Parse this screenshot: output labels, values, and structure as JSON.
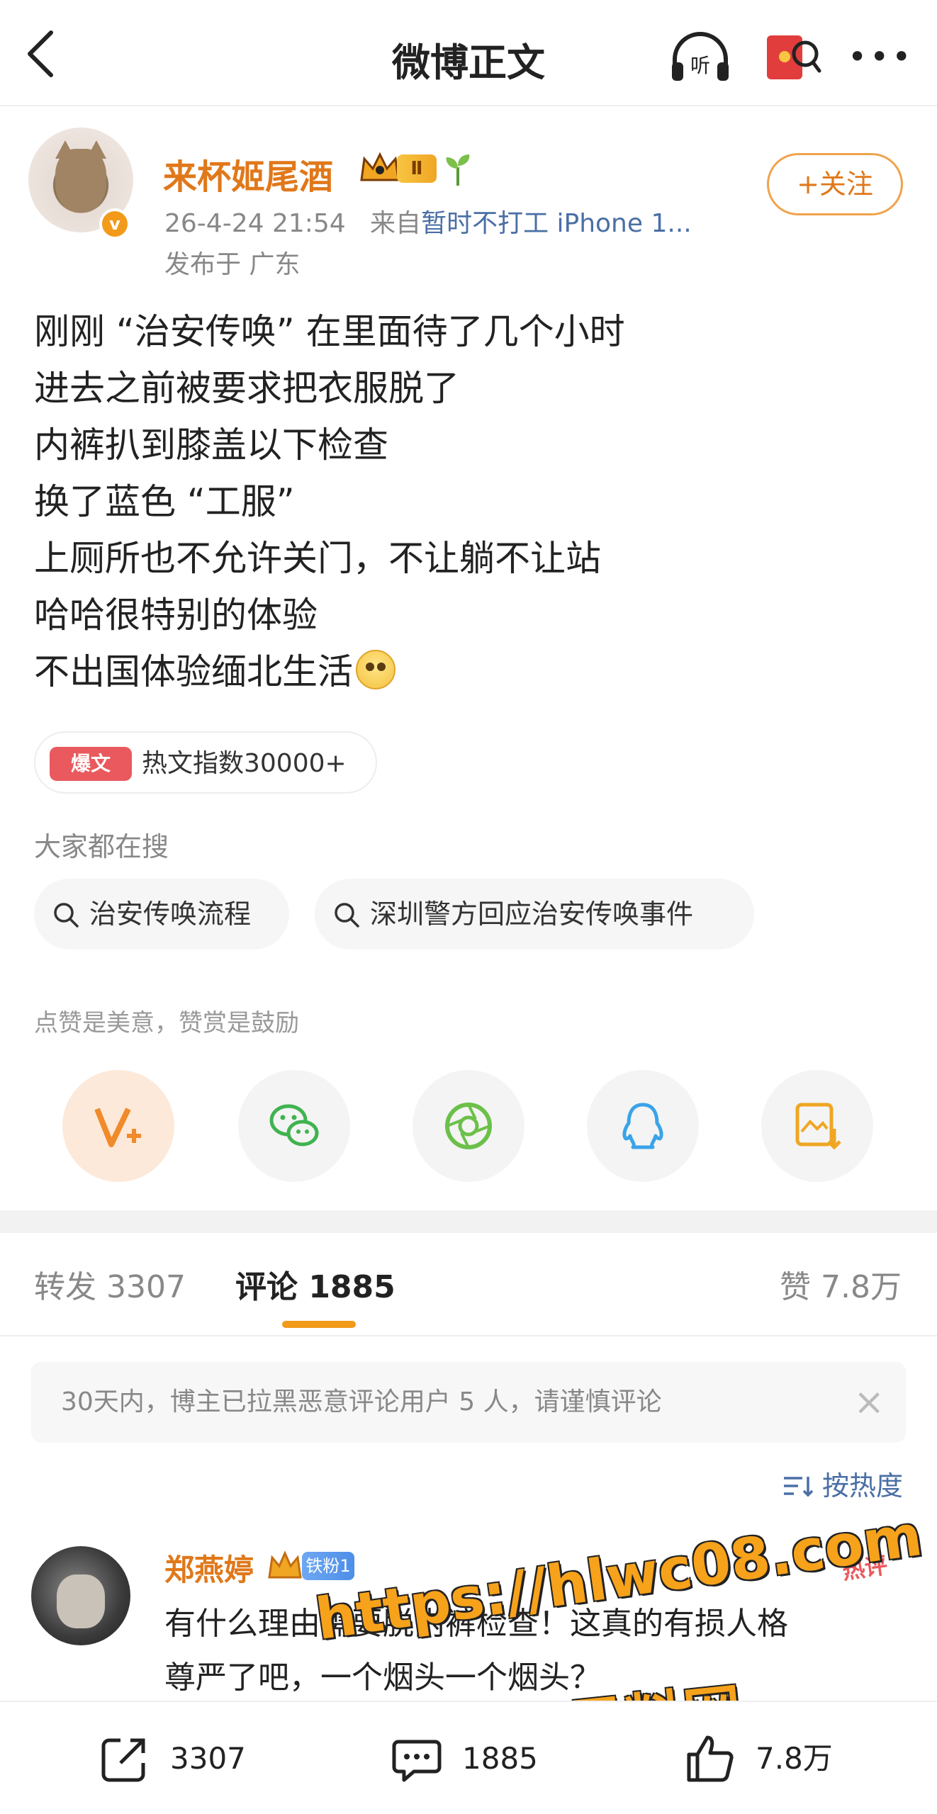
{
  "header": {
    "title": "微博正文"
  },
  "author": {
    "name": "来杯姬尾酒",
    "level": "Ⅱ",
    "verified_mark": "v",
    "timestamp": "26-4-24 21:54",
    "source_prefix": "来自",
    "source": "暂时不打工 iPhone 1...",
    "location": "发布于 广东",
    "follow_label": "+关注"
  },
  "post": {
    "lines": [
      "刚刚 “治安传唤” 在里面待了几个小时",
      "进去之前被要求把衣服脱了",
      "内裤扒到膝盖以下检查",
      "换了蓝色 “工服”",
      "上厕所也不允许关门，不让躺不让站",
      "哈哈很特别的体验",
      "不出国体验缅北生活"
    ]
  },
  "hot_tag": {
    "badge": "爆文",
    "text": "热文指数30000+"
  },
  "search": {
    "label": "大家都在搜",
    "chips": [
      "治安传唤流程",
      "深圳警方回应治安传唤事件"
    ]
  },
  "reward": {
    "label": "点赞是美意，赞赏是鼓励"
  },
  "tabs": {
    "repost": "转发 3307",
    "comment": "评论 1885",
    "like": "赞 7.8万"
  },
  "notice": {
    "text": "30天内，博主已拉黑恶意评论用户 5 人，请谨慎评论",
    "close": "×"
  },
  "sort": {
    "label": "按热度"
  },
  "comment": {
    "name": "郑燕婷",
    "fan_badge": "铁粉1",
    "hot_label": "热评",
    "lines": [
      "有什么理由需要脱内裤检查！这真的有损人格",
      "尊严了吧，一个烟头一个烟头？"
    ]
  },
  "watermark": {
    "url": "https://hlwc08.com",
    "name": "黑料网"
  },
  "bottom_bar": {
    "repost": "3307",
    "comment": "1885",
    "like": "7.8万"
  },
  "colors": {
    "accent": "#e0781a",
    "link": "#4a6fa5",
    "hot": "#e9595d",
    "watermark": "#f7a21b"
  }
}
